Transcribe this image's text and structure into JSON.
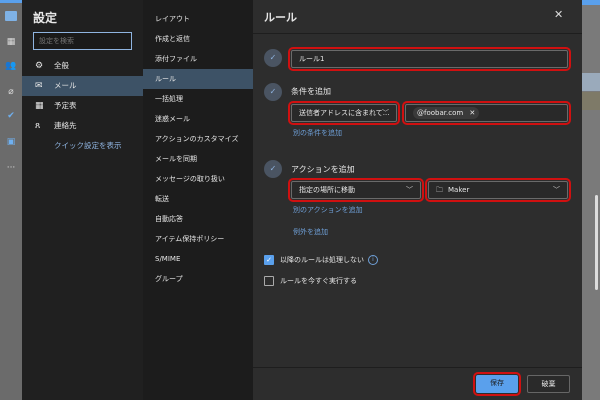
{
  "settings": {
    "title": "設定",
    "search_placeholder": "設定を検索",
    "items": [
      {
        "label": "全般",
        "icon": "gear-icon"
      },
      {
        "label": "メール",
        "icon": "mail-icon"
      },
      {
        "label": "予定表",
        "icon": "calendar-icon"
      },
      {
        "label": "連絡先",
        "icon": "people-icon"
      }
    ],
    "quick_link": "クイック設定を表示"
  },
  "mail_menu": [
    "レイアウト",
    "作成と返信",
    "添付ファイル",
    "ルール",
    "一括処理",
    "迷惑メール",
    "アクションのカスタマイズ",
    "メールを同期",
    "メッセージの取り扱い",
    "転送",
    "自動応答",
    "アイテム保持ポリシー",
    "S/MIME",
    "グループ"
  ],
  "rule": {
    "title": "ルール",
    "name_value": "ルール1",
    "condition_label": "条件を追加",
    "condition_select": "送信者アドレスに含まれて...",
    "condition_value": "@foobar.com",
    "add_condition": "別の条件を追加",
    "action_label": "アクションを追加",
    "action_select": "指定の場所に移動",
    "folder_select": "Maker",
    "add_action": "別のアクションを追加",
    "add_exception": "例外を追加",
    "stop_processing": {
      "label": "以降のルールは処理しない",
      "checked": true
    },
    "run_now": {
      "label": "ルールを今すぐ実行する",
      "checked": false
    },
    "save": "保存",
    "discard": "破棄"
  },
  "colors": {
    "accent": "#5aa0ec",
    "highlight": "#d01010"
  }
}
